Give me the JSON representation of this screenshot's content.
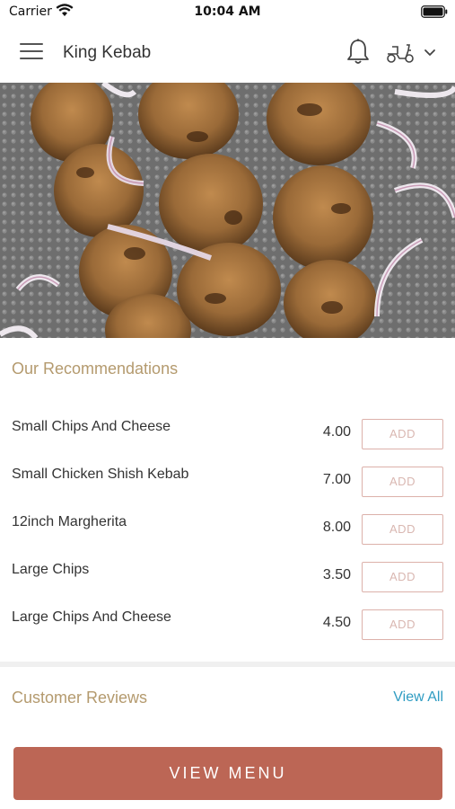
{
  "status_bar": {
    "carrier": "Carrier",
    "time": "10:04 AM"
  },
  "header": {
    "title": "King Kebab",
    "icons": [
      "menu-icon",
      "bell-icon",
      "scooter-icon",
      "chevron-down-icon"
    ]
  },
  "hero": {
    "description_icon": "kebab-photo"
  },
  "recommendations": {
    "title": "Our Recommendations",
    "items": [
      {
        "name": "Small Chips And Cheese",
        "price": "4.00",
        "button": "ADD"
      },
      {
        "name": "Small Chicken Shish Kebab",
        "price": "7.00",
        "button": "ADD"
      },
      {
        "name": "12inch Margherita",
        "price": "8.00",
        "button": "ADD"
      },
      {
        "name": "Large Chips",
        "price": "3.50",
        "button": "ADD"
      },
      {
        "name": "Large Chips And Cheese",
        "price": "4.50",
        "button": "ADD"
      }
    ]
  },
  "reviews": {
    "title": "Customer Reviews",
    "view_all": "View All"
  },
  "footer": {
    "view_menu": "VIEW MENU"
  },
  "colors": {
    "accent": "#bc6655",
    "section_title": "#b49a6e",
    "link": "#2f9cc2",
    "add_border": "#dcb1aa"
  }
}
